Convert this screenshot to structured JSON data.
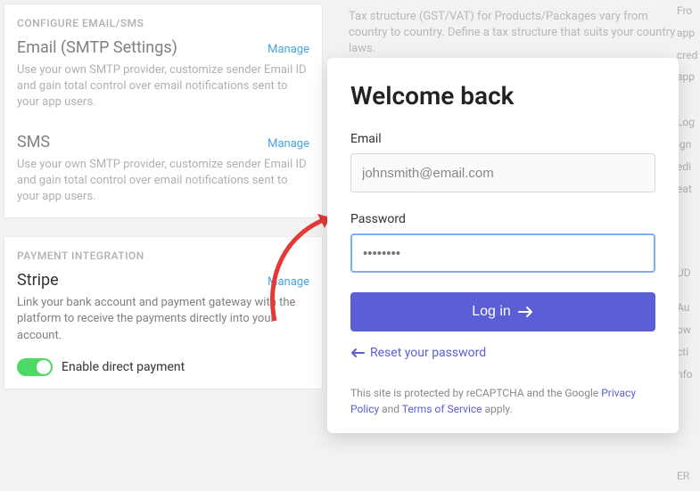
{
  "background": {
    "tax_note": "Tax structure (GST/VAT) for Products/Packages vary from country to country. Define a tax structure that suits your country laws.",
    "configure_header": "CONFIGURE EMAIL/SMS",
    "email_section": {
      "title": "Email (SMTP Settings)",
      "manage": "Manage",
      "desc": "Use your own SMTP provider, customize sender Email ID and gain total control over email notifications sent to your app users."
    },
    "sms_section": {
      "title": "SMS",
      "manage": "Manage",
      "desc": "Use your own SMTP provider, customize sender Email ID and gain total control over email notifications sent to your app users."
    },
    "payment_header": "PAYMENT INTEGRATION",
    "stripe_section": {
      "title": "Stripe",
      "manage": "Manage",
      "desc": "Link your bank account and payment gateway with the platform to receive the payments directly into your account.",
      "toggle_label": "Enable direct payment",
      "toggle_on": true
    },
    "right_fragments": {
      "a": "Fro",
      "b": "app",
      "c": "cred",
      "d": "app",
      "e": "Log",
      "f": "ign",
      "g": "edi",
      "h": "eat",
      "i": "UD",
      "j": "Au",
      "k": "ow",
      "l": "cti",
      "m": "nfo",
      "n": "ER"
    }
  },
  "modal": {
    "title": "Welcome back",
    "email_label": "Email",
    "email_value": "johnsmith@email.com",
    "password_label": "Password",
    "password_value": "",
    "password_placeholder": "••••••••",
    "login_label": "Log in",
    "reset_label": "Reset your password",
    "legal_prefix": "This site is protected by reCAPTCHA and the Google ",
    "legal_pp": "Privacy Policy",
    "legal_mid": " and ",
    "legal_tos": "Terms of Service",
    "legal_suffix": " apply."
  }
}
